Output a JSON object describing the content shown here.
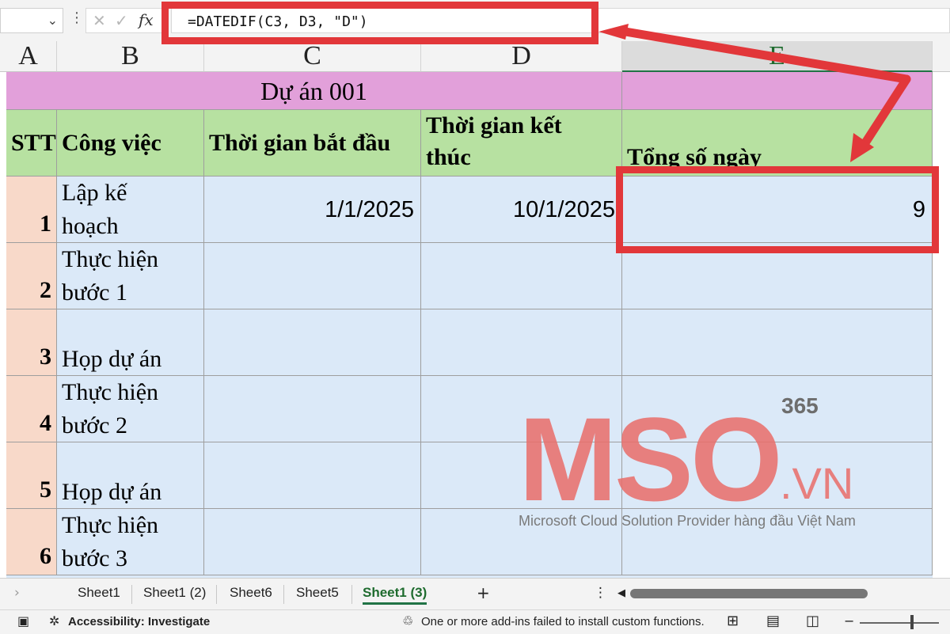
{
  "formula": {
    "text": "=DATEDIF(C3, D3, \"D\")",
    "fx_label": "fx",
    "cancel_glyph": "✕",
    "enter_glyph": "✓"
  },
  "columns": [
    "A",
    "B",
    "C",
    "D",
    "E"
  ],
  "sheet": {
    "title": "Dự án 001",
    "headers": {
      "stt": "STT",
      "task": "Công việc",
      "start": "Thời gian bắt đầu",
      "end_line1": "Thời gian kết",
      "end_line2": "thúc",
      "total": "Tổng số ngày"
    },
    "rows": [
      {
        "stt": "1",
        "task_l1": "Lập kế",
        "task_l2": "hoạch",
        "start": "1/1/2025",
        "end": "10/1/2025",
        "total": "9"
      },
      {
        "stt": "2",
        "task_l1": "Thực hiện",
        "task_l2": "bước 1",
        "start": "",
        "end": "",
        "total": ""
      },
      {
        "stt": "3",
        "task_l1": "",
        "task_l2": "Họp dự án",
        "start": "",
        "end": "",
        "total": ""
      },
      {
        "stt": "4",
        "task_l1": "Thực hiện",
        "task_l2": "bước 2",
        "start": "",
        "end": "",
        "total": ""
      },
      {
        "stt": "5",
        "task_l1": "",
        "task_l2": "Họp dự án",
        "start": "",
        "end": "",
        "total": ""
      },
      {
        "stt": "6",
        "task_l1": "Thực hiện",
        "task_l2": "bước 3",
        "start": "",
        "end": "",
        "total": ""
      }
    ]
  },
  "watermark": {
    "logo_text": "MSO",
    "suffix": ".VN",
    "number": "365",
    "tagline": "Microsoft Cloud Solution Provider hàng đầu Việt Nam"
  },
  "tabs": [
    "Sheet1",
    "Sheet1 (2)",
    "Sheet6",
    "Sheet5",
    "Sheet1 (3)"
  ],
  "active_tab": "Sheet1 (3)",
  "status": {
    "accessibility": "Accessibility: Investigate",
    "message": "One or more add-ins failed to install custom functions."
  },
  "colors": {
    "annotation_red": "#e2373a",
    "title_fill": "#e2a0da",
    "header_fill": "#b7e1a1",
    "data_fill": "#dbe9f8",
    "stt_fill": "#f8d9c9",
    "excel_green": "#217346"
  }
}
